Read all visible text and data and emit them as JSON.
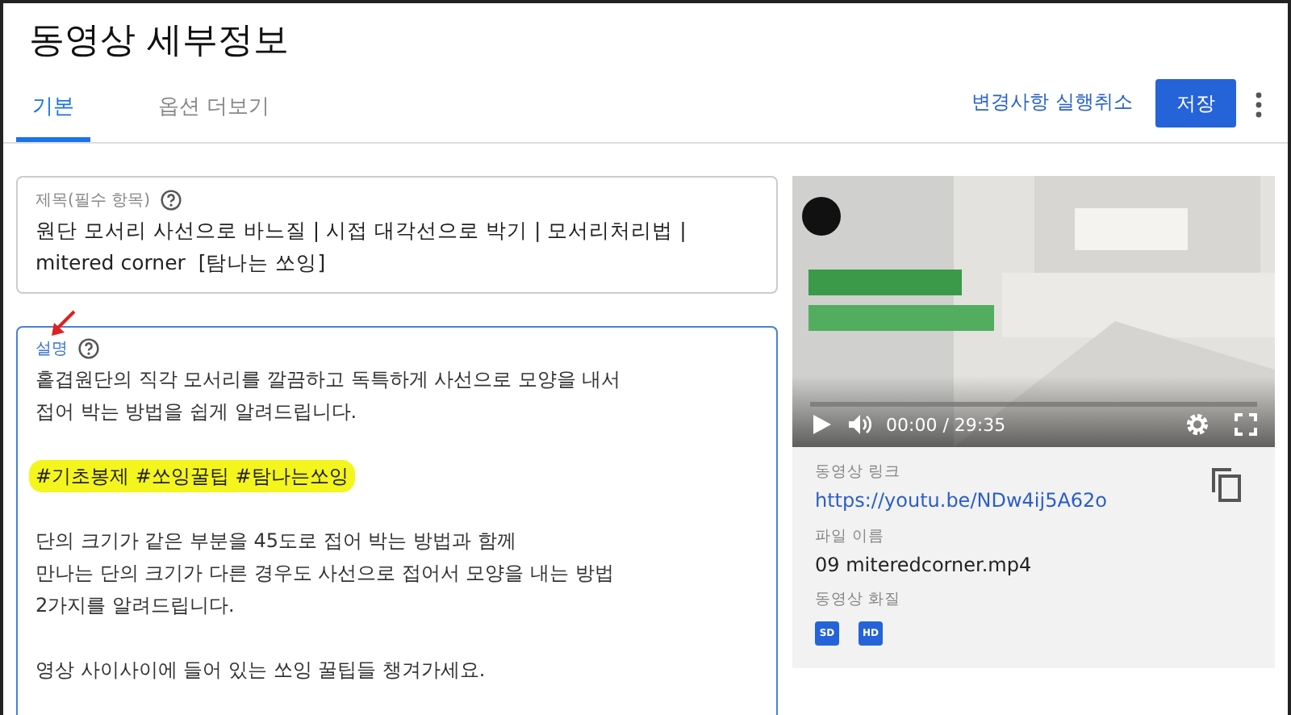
{
  "header": {
    "title": "동영상 세부정보",
    "undo": "변경사항 실행취소",
    "save": "저장"
  },
  "tabs": [
    {
      "label": "기본",
      "selected": true
    },
    {
      "label": "옵션 더보기",
      "selected": false
    }
  ],
  "title_field": {
    "label": "제목(필수 항목)",
    "value": "원단 모서리 사선으로 바느질 | 시접 대각선으로 박기 | 모서리처리법 |  mitered corner  [탐나는 쏘잉]"
  },
  "description_field": {
    "label": "설명",
    "paragraphs": [
      {
        "lines": [
          "홑겹원단의 직각 모서리를 깔끔하고 독특하게 사선으로 모양을 내서",
          "접어 박는 방법을 쉽게 알려드립니다."
        ],
        "highlighted": false
      },
      {
        "lines": [
          "#기초봉제 #쏘잉꿀팁 #탐나는쏘잉"
        ],
        "highlighted": true
      },
      {
        "lines": [
          "단의 크기가 같은 부분을 45도로 접어 박는 방법과 함께",
          "만나는 단의 크기가 다른 경우도 사선으로 접어서 모양을 내는 방법",
          "2가지를 알려드립니다."
        ],
        "highlighted": false
      },
      {
        "lines": [
          "영상 사이사이에 들어 있는 쏘잉 꿀팁들 챙겨가세요."
        ],
        "highlighted": false
      }
    ]
  },
  "video": {
    "kind": "picture",
    "time": "00:00 / 29:35",
    "level": 0
  },
  "info": {
    "link_label": "동영상 링크",
    "link": "https://youtu.be/NDw4ij5A62o",
    "file_label": "파일 이름",
    "file": "09 miteredcorner.mp4",
    "quality_label": "동영상 화질",
    "qualities": [
      "SD",
      "HD"
    ]
  }
}
